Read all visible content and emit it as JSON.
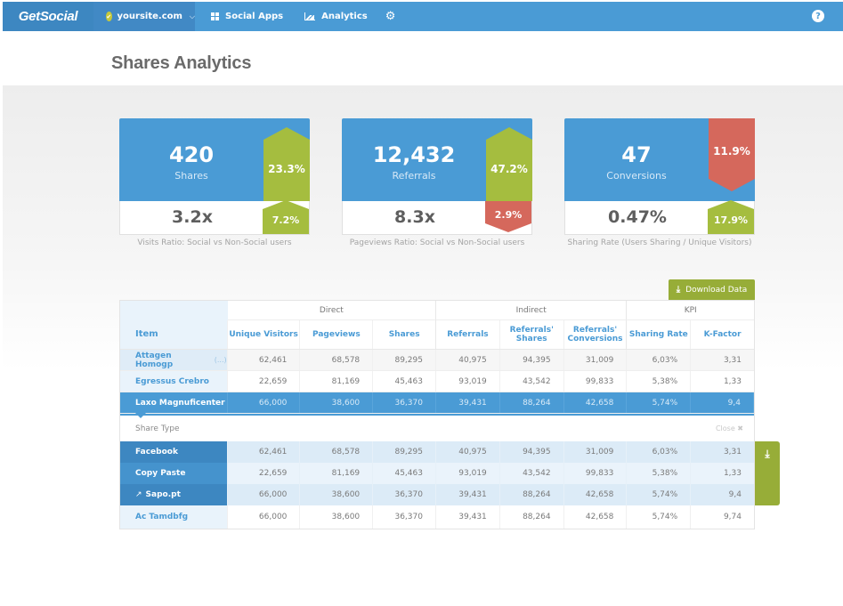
{
  "topbar": {
    "logo": "GetSocial",
    "site": "yoursite.com",
    "nav": [
      {
        "label": "Social Apps",
        "icon": "grid-icon"
      },
      {
        "label": "Analytics",
        "icon": "chart-icon"
      }
    ],
    "settings_icon": "⚙",
    "help_icon": "?"
  },
  "page": {
    "title": "Shares Analytics"
  },
  "cards": [
    {
      "value": "420",
      "label": "Shares",
      "top_badge": "23.3%",
      "top_trend": "up",
      "ratio": "3.2x",
      "bottom_badge": "7.2%",
      "bottom_trend": "up",
      "caption": "Visits Ratio: Social vs Non-Social users"
    },
    {
      "value": "12,432",
      "label": "Referrals",
      "top_badge": "47.2%",
      "top_trend": "up",
      "ratio": "8.3x",
      "bottom_badge": "2.9%",
      "bottom_trend": "down",
      "caption": "Pageviews Ratio: Social vs Non-Social users"
    },
    {
      "value": "47",
      "label": "Conversions",
      "top_badge": "11.9%",
      "top_trend": "down",
      "ratio": "0.47%",
      "bottom_badge": "17.9%",
      "bottom_trend": "up",
      "caption": "Sharing Rate (Users Sharing / Unique Visitors)"
    }
  ],
  "colors": {
    "primary": "#4a9bd5",
    "positive": "#a5bd3f",
    "negative": "#d5685c",
    "download": "#97ad38"
  },
  "download_button": "Download Data",
  "table": {
    "groups": [
      "Direct",
      "Indirect",
      "KPI"
    ],
    "columns": [
      "Item",
      "Unique Visitors",
      "Pageviews",
      "Shares",
      "Referrals",
      "Referrals' Shares",
      "Referrals' Conversions",
      "Sharing Rate",
      "K-Factor"
    ],
    "rows": [
      {
        "item": "Attagen Homogp",
        "suffix": "(...)",
        "values": [
          "62,461",
          "68,578",
          "89,295",
          "40,975",
          "94,395",
          "31,009",
          "6,03%",
          "3,31"
        ]
      },
      {
        "item": "Egressus Crebro",
        "values": [
          "22,659",
          "81,169",
          "45,463",
          "93,019",
          "43,542",
          "99,833",
          "5,38%",
          "1,33"
        ]
      },
      {
        "item": "Laxo Magnuficenter",
        "values": [
          "66,000",
          "38,600",
          "36,370",
          "39,431",
          "88,264",
          "42,658",
          "5,74%",
          "9,4"
        ]
      }
    ],
    "share_type": {
      "label": "Share Type",
      "close": "Close ✖"
    },
    "sub_rows": [
      {
        "item": "Facebook",
        "values": [
          "62,461",
          "68,578",
          "89,295",
          "40,975",
          "94,395",
          "31,009",
          "6,03%",
          "3,31"
        ]
      },
      {
        "item": "Copy Paste",
        "values": [
          "22,659",
          "81,169",
          "45,463",
          "93,019",
          "43,542",
          "99,833",
          "5,38%",
          "1,33"
        ]
      },
      {
        "item": "Sapo.pt",
        "values": [
          "66,000",
          "38,600",
          "36,370",
          "39,431",
          "88,264",
          "42,658",
          "5,74%",
          "9,4"
        ]
      }
    ],
    "last_row": {
      "item": "Ac Tamdbfg",
      "values": [
        "66,000",
        "38,600",
        "36,370",
        "39,431",
        "88,264",
        "42,658",
        "5,74%",
        "9,74"
      ]
    }
  }
}
